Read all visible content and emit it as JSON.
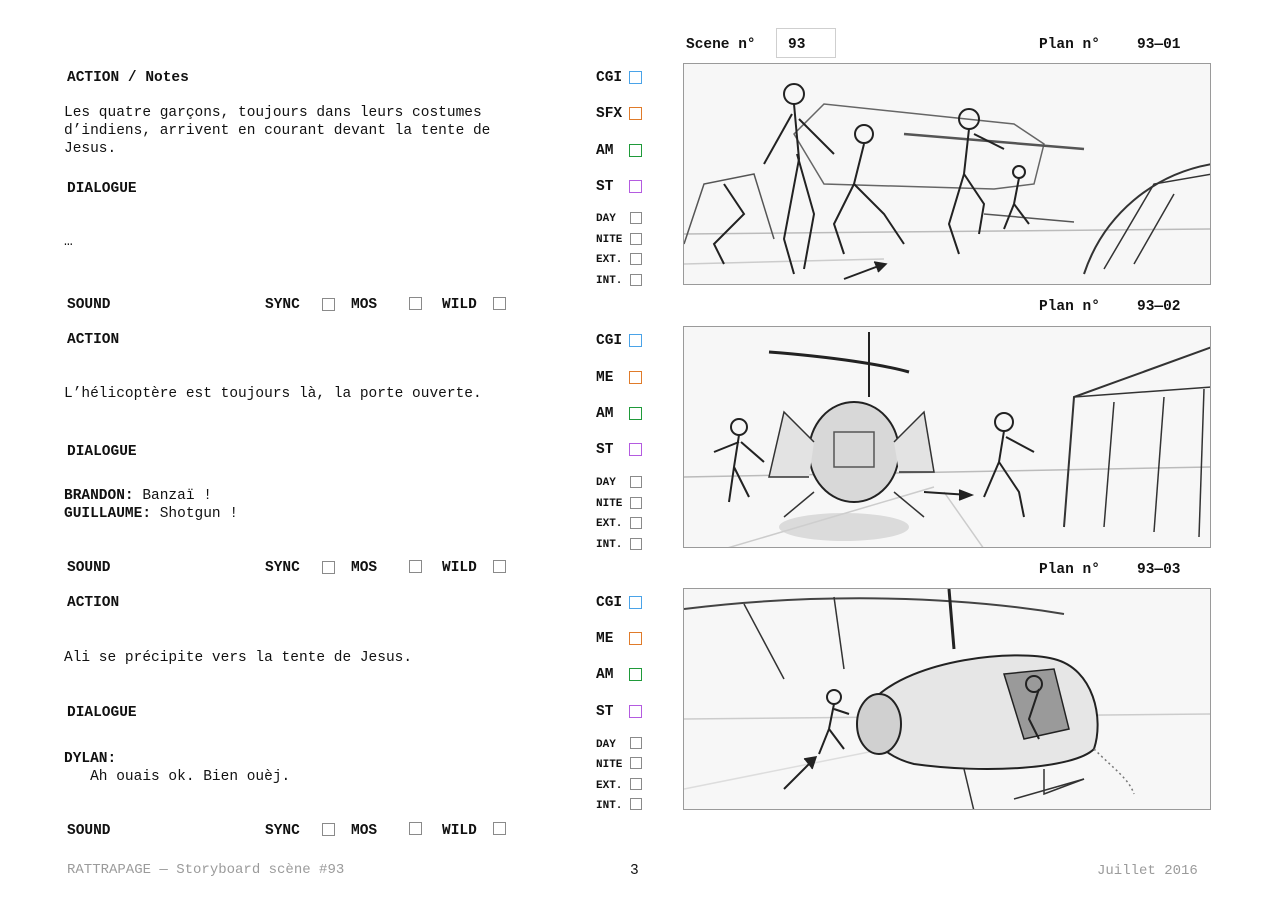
{
  "header": {
    "scene_label": "Scene n°",
    "scene_value": "93"
  },
  "colors": {
    "cgi": "#4aa3e8",
    "sfx": "#e07b2a",
    "me": "#e07b2a",
    "am": "#1f9a3a",
    "st": "#b45be0",
    "plain": "#8a8a8a"
  },
  "shots": [
    {
      "plan_label": "Plan n°",
      "plan_value": "93—01",
      "action_label": "ACTION / Notes",
      "action_lines": [
        "Les quatre garçons, toujours dans leurs costumes",
        "d’indiens, arrivent en courant devant la tente de",
        "Jesus."
      ],
      "dialogue_label": "DIALOGUE",
      "dialogue_lines": [
        {
          "speaker": "",
          "text": "…"
        }
      ],
      "sound": {
        "label": "SOUND",
        "sync": "SYNC",
        "mos": "MOS",
        "wild": "WILD"
      },
      "checks": {
        "cgi": "CGI",
        "fx": "SFX",
        "am": "AM",
        "st": "ST",
        "day": "DAY",
        "nite": "NITE",
        "ext": "EXT.",
        "int": "INT."
      },
      "image_name": "storyboard-sketch-93-01"
    },
    {
      "plan_label": "Plan n°",
      "plan_value": "93—02",
      "action_label": "ACTION",
      "action_lines": [
        "L’hélicoptère est toujours là, la porte ouverte."
      ],
      "dialogue_label": "DIALOGUE",
      "dialogue_lines": [
        {
          "speaker": "BRANDON:",
          "text": " Banzaï !"
        },
        {
          "speaker": "GUILLAUME:",
          "text": " Shotgun !"
        }
      ],
      "sound": {
        "label": "SOUND",
        "sync": "SYNC",
        "mos": "MOS",
        "wild": "WILD"
      },
      "checks": {
        "cgi": "CGI",
        "fx": "ME",
        "am": "AM",
        "st": "ST",
        "day": "DAY",
        "nite": "NITE",
        "ext": "EXT.",
        "int": "INT."
      },
      "image_name": "storyboard-sketch-93-02"
    },
    {
      "plan_label": "Plan n°",
      "plan_value": "93—03",
      "action_label": "ACTION",
      "action_lines": [
        "Ali se précipite vers la tente de Jesus."
      ],
      "dialogue_label": "DIALOGUE",
      "dialogue_lines": [
        {
          "speaker": "DYLAN:",
          "text": ""
        },
        {
          "speaker": "",
          "text": "   Ah ouais ok. Bien ouèj."
        }
      ],
      "sound": {
        "label": "SOUND",
        "sync": "SYNC",
        "mos": "MOS",
        "wild": "WILD"
      },
      "checks": {
        "cgi": "CGI",
        "fx": "ME",
        "am": "AM",
        "st": "ST",
        "day": "DAY",
        "nite": "NITE",
        "ext": "EXT.",
        "int": "INT."
      },
      "image_name": "storyboard-sketch-93-03"
    }
  ],
  "footer": {
    "left": "RATTRAPAGE — Storyboard scène #93",
    "page": "3",
    "right": "Juillet 2016"
  }
}
